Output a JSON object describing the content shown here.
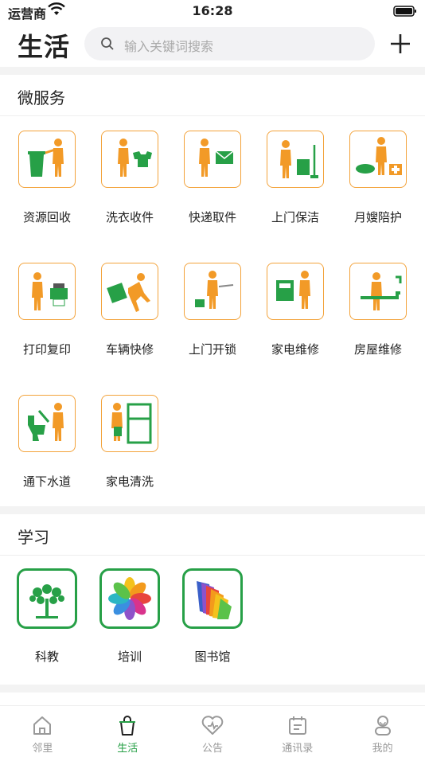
{
  "status_bar": {
    "carrier": "运营商",
    "time": "16:28"
  },
  "header": {
    "title": "生活",
    "search_placeholder": "输入关键词搜索"
  },
  "sections": {
    "micro_services": {
      "title": "微服务",
      "items": [
        {
          "label": "资源回收",
          "icon": "recycle-icon"
        },
        {
          "label": "洗衣收件",
          "icon": "laundry-icon"
        },
        {
          "label": "快递取件",
          "icon": "courier-icon"
        },
        {
          "label": "上门保洁",
          "icon": "cleaning-icon"
        },
        {
          "label": "月嫂陪护",
          "icon": "nanny-icon"
        },
        {
          "label": "打印复印",
          "icon": "printer-icon"
        },
        {
          "label": "车辆快修",
          "icon": "car-repair-icon"
        },
        {
          "label": "上门开锁",
          "icon": "locksmith-icon"
        },
        {
          "label": "家电维修",
          "icon": "appliance-repair-icon"
        },
        {
          "label": "房屋维修",
          "icon": "house-repair-icon"
        },
        {
          "label": "通下水道",
          "icon": "plumbing-icon"
        },
        {
          "label": "家电清洗",
          "icon": "appliance-cleaning-icon"
        }
      ]
    },
    "learning": {
      "title": "学习",
      "items": [
        {
          "label": "科教",
          "icon": "tree-icon"
        },
        {
          "label": "培训",
          "icon": "pinwheel-icon"
        },
        {
          "label": "图书馆",
          "icon": "books-icon"
        }
      ]
    }
  },
  "tabbar": {
    "items": [
      {
        "label": "邻里",
        "icon": "home-icon"
      },
      {
        "label": "生活",
        "icon": "bag-icon"
      },
      {
        "label": "公告",
        "icon": "heart-icon"
      },
      {
        "label": "通讯录",
        "icon": "calendar-icon"
      },
      {
        "label": "我的",
        "icon": "profile-icon"
      }
    ],
    "active": "生活"
  },
  "colors": {
    "accent": "#27a047",
    "tile_border": "#f3a33b",
    "figure": "#f29a27",
    "green_item": "#27a047"
  }
}
